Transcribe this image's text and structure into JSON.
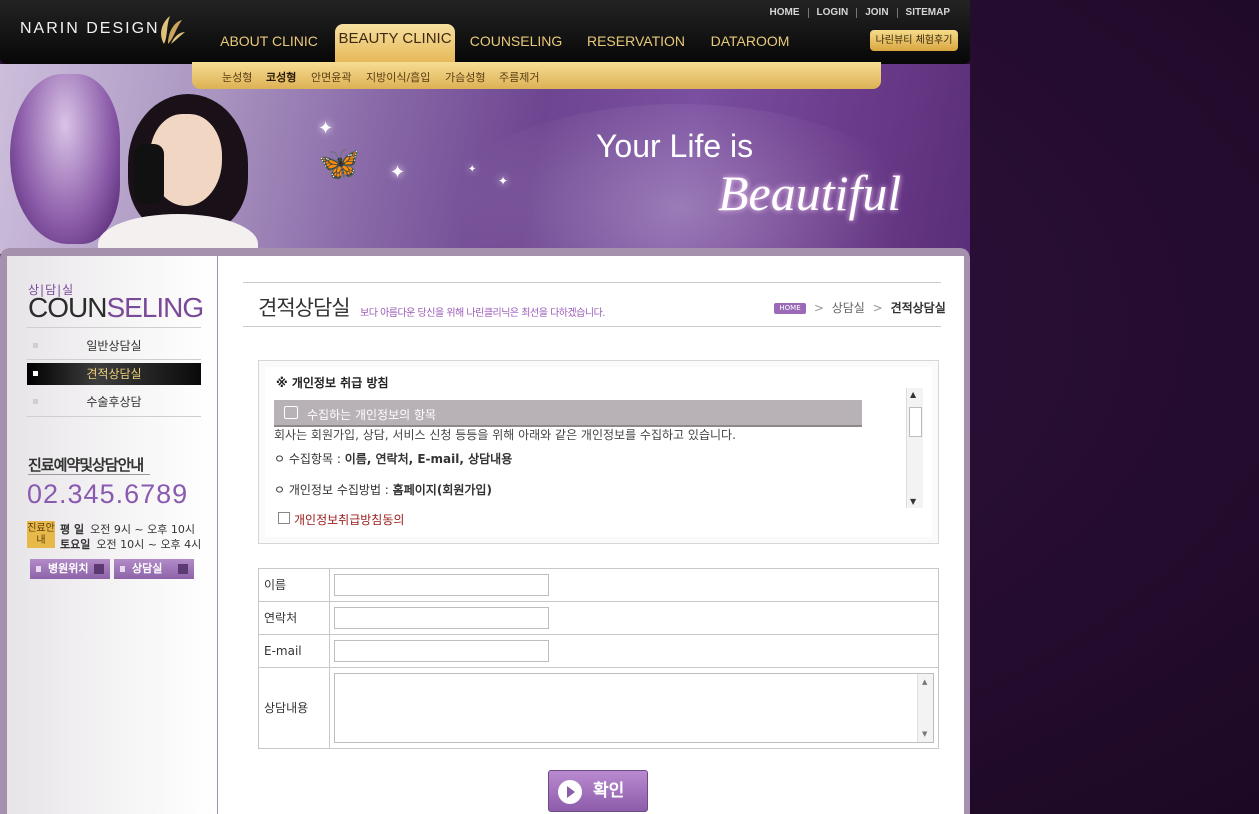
{
  "brand": {
    "logo_text": "NARIN DESIGN"
  },
  "util_nav": [
    "HOME",
    "LOGIN",
    "JOIN",
    "SITEMAP"
  ],
  "gnb": [
    "ABOUT CLINIC",
    "BEAUTY CLINIC",
    "COUNSELING",
    "RESERVATION",
    "DATAROOM"
  ],
  "gnb_active": "BEAUTY CLINIC",
  "review_button": "나린뷰티 체험후기",
  "subnav": [
    "눈성형",
    "코성형",
    "안면윤곽",
    "지방이식/흡입",
    "가슴성형",
    "주름제거"
  ],
  "subnav_active": "코성형",
  "hero": {
    "line1": "Your Life is",
    "line2": "Beautiful"
  },
  "sidebar": {
    "title_ko": "상|담|실",
    "title_en_a": "COUN",
    "title_en_b": "SELING",
    "items": [
      {
        "label": "일반상담실",
        "active": false
      },
      {
        "label": "견적상담실",
        "active": true
      },
      {
        "label": "수술후상담",
        "active": false
      }
    ],
    "info_title": "진료예약및상담안내",
    "phone": "02.345.6789",
    "hours_badge": "진료안내",
    "hours": [
      {
        "day": "평  일",
        "time": "오전 9시 ~ 오후 10시"
      },
      {
        "day": "토요일",
        "time": "오전 10시 ~ 오후 4시"
      }
    ],
    "buttons": [
      "병원위치",
      "상담실"
    ]
  },
  "page": {
    "title": "견적상담실",
    "desc": "보다 아름다운 당신을 위해 나린클리닉은 최선을 다하겠습니다.",
    "breadcrumb": {
      "home": "HOME",
      "parent": "상담실",
      "current": "견적상담실"
    }
  },
  "policy": {
    "title": "※ 개인정보 취급 방침",
    "section_title": "수집하는 개인정보의 항목",
    "intro": "회사는 회원가입, 상담, 서비스 신청 등등을 위해 아래와 같은 개인정보를 수집하고 있습니다.",
    "rows": [
      {
        "label": "ㅇ 수집항목 : ",
        "value": "이름, 연락처, E-mail, 상담내용"
      },
      {
        "label": "ㅇ 개인정보 수집방법 : ",
        "value": "홈페이지(회원가입)"
      }
    ],
    "agree_label": "개인정보취급방침동의"
  },
  "form": {
    "fields": [
      {
        "label": "이름",
        "value": ""
      },
      {
        "label": "연락처",
        "value": ""
      },
      {
        "label": "E-mail",
        "value": ""
      }
    ],
    "textarea_label": "상담내용",
    "textarea_value": "",
    "submit": "확인"
  },
  "colors": {
    "accent_purple": "#8d5cab",
    "gold": "#e6b755",
    "dark": "#070707"
  }
}
